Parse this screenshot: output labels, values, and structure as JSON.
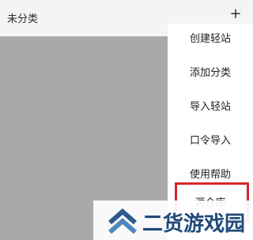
{
  "header": {
    "title": "未分类",
    "add_icon": "plus-icon",
    "add_label": "+"
  },
  "menu": {
    "items": [
      {
        "label": "创建轻站"
      },
      {
        "label": "添加分类"
      },
      {
        "label": "导入轻站"
      },
      {
        "label": "口令导入"
      },
      {
        "label": "使用帮助"
      },
      {
        "label": "源仓库"
      }
    ]
  },
  "watermark": {
    "text": "二货游戏园",
    "icon": "double-chevron-up-icon"
  },
  "colors": {
    "highlight": "#d8262b",
    "watermark_text": "#1f4a7a"
  }
}
